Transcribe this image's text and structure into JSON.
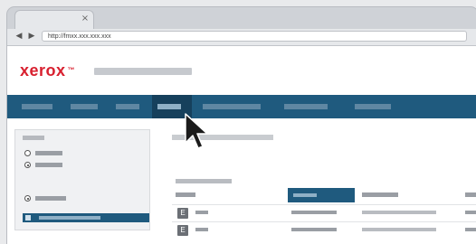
{
  "browser": {
    "tab_close": "×",
    "back": "◀",
    "forward": "▶",
    "url": "http://fmxx.xxx.xxx.xxx"
  },
  "brand": {
    "logo": "xerox",
    "logo_mark": "™",
    "app_title": "",
    "accent": "#d8202f"
  },
  "nav": {
    "items": [
      {
        "label": ""
      },
      {
        "label": ""
      },
      {
        "label": ""
      },
      {
        "label": ""
      },
      {
        "label": ""
      },
      {
        "label": ""
      },
      {
        "label": ""
      }
    ],
    "active_index": 3,
    "color": "#1f5a7e"
  },
  "filter_panel": {
    "heading": "",
    "radios": [
      {
        "label": "",
        "checked": false
      },
      {
        "label": "",
        "checked": true
      }
    ],
    "radio_lower": {
      "label": "",
      "checked": true
    },
    "selected_item": ""
  },
  "main": {
    "section_title": "",
    "table_caption": "",
    "columns": [
      "",
      "",
      "",
      ""
    ],
    "active_column": 1,
    "rows": [
      {
        "icon": "E",
        "cells": [
          "",
          "",
          "",
          ""
        ]
      },
      {
        "icon": "E",
        "cells": [
          "",
          "",
          "",
          ""
        ]
      }
    ]
  }
}
